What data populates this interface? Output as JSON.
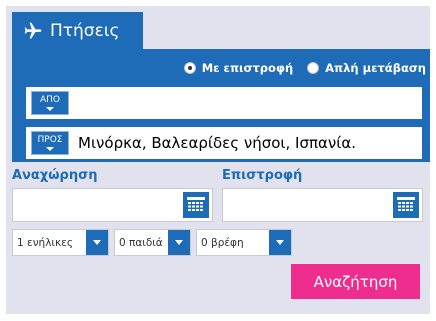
{
  "tab": {
    "label": "Πτήσεις",
    "icon": "airplane-icon"
  },
  "trip_type": {
    "options": [
      {
        "label": "Με επιστροφή",
        "selected": true
      },
      {
        "label": "Απλή μετάβαση",
        "selected": false
      }
    ]
  },
  "from": {
    "badge": "ΑΠΟ",
    "value": ""
  },
  "to": {
    "badge": "ΠΡΟΣ",
    "value": "Μινόρκα, Βαλεαρίδες νήσοι, Ισπανία."
  },
  "departure": {
    "label": "Αναχώρηση",
    "value": ""
  },
  "return": {
    "label": "Επιστροφή",
    "value": ""
  },
  "passengers": {
    "adults": "1 ενήλικες",
    "children": "0 παιδιά",
    "infants": "0 βρέφη"
  },
  "search_label": "Αναζήτηση",
  "colors": {
    "primary": "#1e6bb8",
    "accent": "#ee2d8f",
    "background": "#e2e2ee"
  }
}
